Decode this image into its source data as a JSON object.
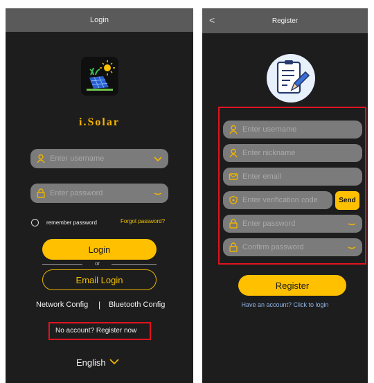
{
  "login": {
    "title": "Login",
    "brand": "i.Solar",
    "username_placeholder": "Enter username",
    "password_placeholder": "Enter password",
    "remember_label": "remember password",
    "forgot_link": "Forgot password?",
    "login_button": "Login",
    "or_label": "or",
    "email_login_button": "Email Login",
    "network_config": "Network Config",
    "separator": "|",
    "bluetooth_config": "Bluetooth Config",
    "register_link": "No account? Register now",
    "language": "English"
  },
  "register": {
    "back": "<",
    "title": "Register",
    "fields": {
      "username": "Enter username",
      "nickname": "Enter nickname",
      "email": "Enter email",
      "code": "Enter verification code",
      "password": "Enter password",
      "confirm": "Confirm password"
    },
    "send_button": "Send",
    "register_button": "Register",
    "login_link": "Have an account? Click to login"
  },
  "colors": {
    "accent": "#ffc000",
    "background": "#1d1d1d",
    "field": "#7b7b7b",
    "highlight": "#e0141e"
  }
}
